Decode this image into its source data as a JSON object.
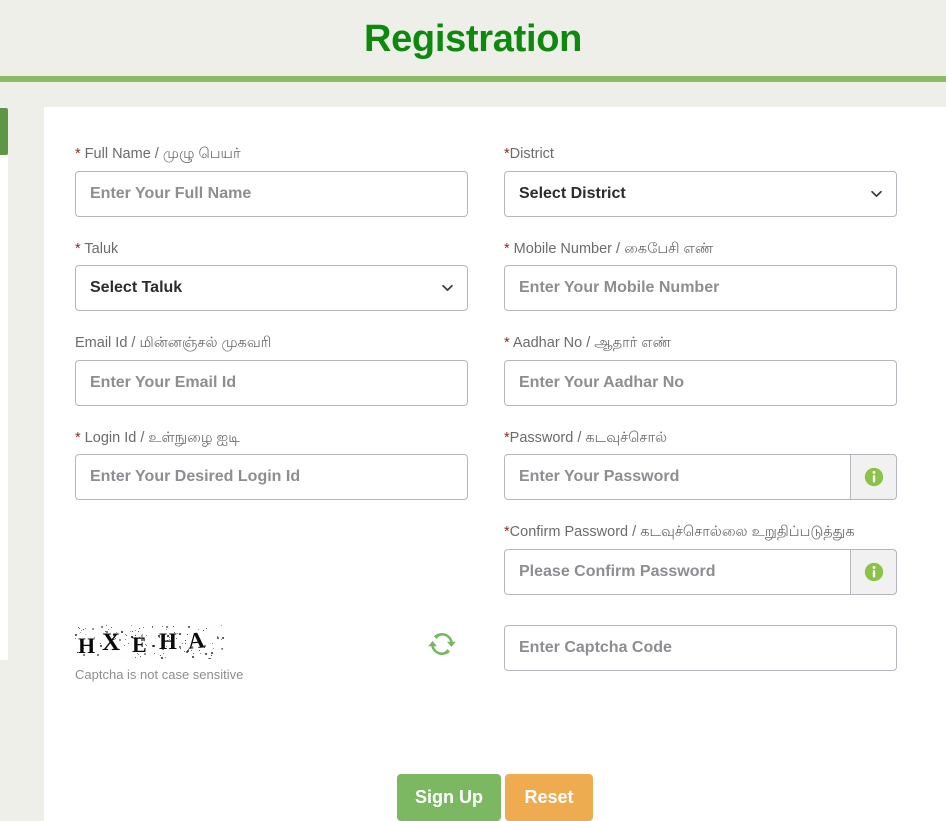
{
  "header": {
    "title": "Registration"
  },
  "colors": {
    "title_green": "#0d8a0d",
    "rule_green": "#8bba64",
    "signup_green": "#7cb862",
    "reset_orange": "#efab4f",
    "info_icon_green": "#8bc34a",
    "refresh_icon_green": "#78b85c",
    "required_asterisk": "#8c2b2b",
    "page_background": "#efefea",
    "card_background": "#ffffff",
    "border_gray": "#b6b6bd",
    "placeholder_gray": "#8d8d92",
    "label_gray": "#6b6b6b"
  },
  "form": {
    "left_column": [
      {
        "key": "full_name",
        "required": true,
        "asterisk": "*",
        "label": " Full Name / முழு பெயர்",
        "type": "text",
        "placeholder": "Enter Your Full Name",
        "value": ""
      },
      {
        "key": "taluk",
        "required": true,
        "asterisk": "*",
        "label": " Taluk",
        "type": "select",
        "selected": "Select Taluk",
        "options": [
          "Select Taluk"
        ]
      },
      {
        "key": "email_id",
        "required": false,
        "asterisk": "",
        "label": "Email Id / மின்னஞ்சல் முகவரி",
        "type": "text",
        "placeholder": "Enter Your Email Id",
        "value": ""
      },
      {
        "key": "login_id",
        "required": true,
        "asterisk": "*",
        "label": " Login Id / உள்நுழை ஐடி",
        "type": "text",
        "placeholder": "Enter Your Desired Login Id",
        "value": ""
      }
    ],
    "right_column": [
      {
        "key": "district",
        "required": true,
        "asterisk": "*",
        "label": "District",
        "type": "select",
        "selected": "Select District",
        "options": [
          "Select District"
        ]
      },
      {
        "key": "mobile_number",
        "required": true,
        "asterisk": "*",
        "label": " Mobile Number / கைபேசி எண்",
        "type": "text",
        "placeholder": "Enter Your Mobile Number",
        "value": ""
      },
      {
        "key": "aadhar_no",
        "required": true,
        "asterisk": "*",
        "label": " Aadhar No / ஆதார் எண்",
        "type": "text",
        "placeholder": "Enter Your Aadhar No",
        "value": ""
      },
      {
        "key": "password",
        "required": true,
        "asterisk": "*",
        "label": "Password / கடவுச்சொல்",
        "type": "password",
        "placeholder": "Enter Your Password",
        "value": "",
        "addon_icon": "info-icon"
      },
      {
        "key": "confirm_password",
        "required": true,
        "asterisk": "*",
        "label": "Confirm Password / கடவுச்சொல்லை உறுதிப்படுத்துக",
        "type": "password",
        "placeholder": "Please Confirm Password",
        "value": "",
        "addon_icon": "info-icon"
      }
    ]
  },
  "captcha": {
    "code_text": "HXEHA",
    "characters": [
      "H",
      "X",
      "E",
      "H",
      "A"
    ],
    "note": "Captcha is not case sensitive",
    "refresh_icon": "refresh-icon",
    "input_placeholder": "Enter Captcha Code",
    "input_value": ""
  },
  "actions": {
    "signup_label": "Sign Up",
    "reset_label": "Reset"
  }
}
